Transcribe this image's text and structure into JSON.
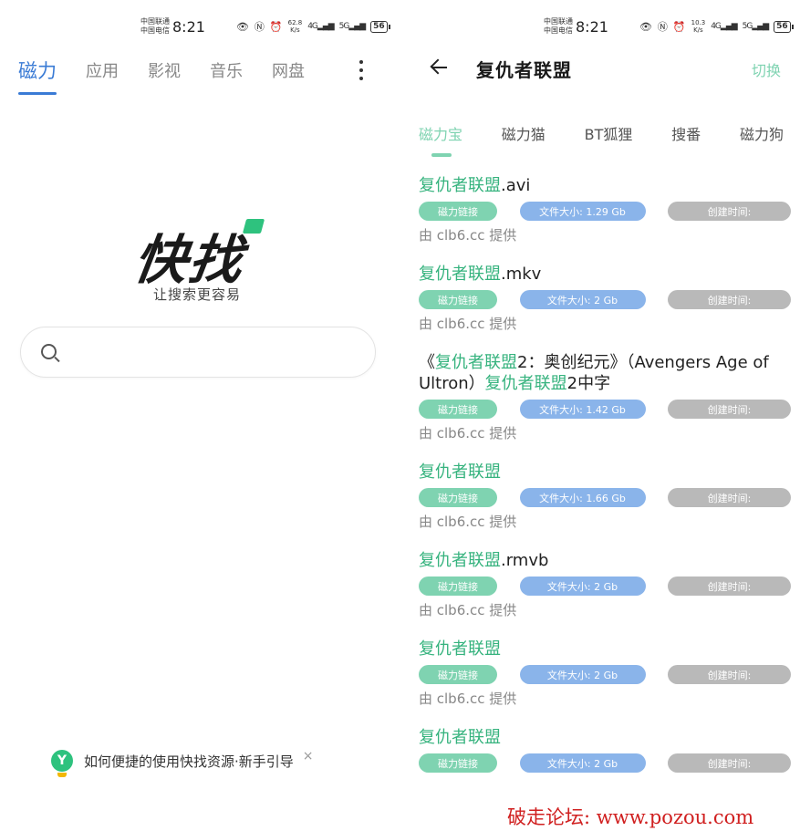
{
  "status_bar": {
    "carrier1": "中国联通",
    "carrier2": "中国电信",
    "time": "8:21",
    "left_speed": "62.8",
    "right_speed": "10.3",
    "speed_unit": "K/s",
    "signal1": "4G",
    "signal2": "5G",
    "battery": "56"
  },
  "home": {
    "tabs": [
      "磁力",
      "应用",
      "影视",
      "音乐",
      "网盘"
    ],
    "logo": "快找",
    "slogan": "让搜索更容易",
    "search_placeholder": "",
    "guide_icon": "Y",
    "guide_text": "如何便捷的使用快找资源·新手引导",
    "close": "×"
  },
  "results_page": {
    "title": "复仇者联盟",
    "switch_label": "切换",
    "source_tabs": [
      "磁力宝",
      "磁力猫",
      "BT狐狸",
      "搜番",
      "磁力狗"
    ],
    "items": [
      {
        "prefix": "",
        "hl": "复仇者联盟",
        "mid": ".avi",
        "hl2": "",
        "suffix": "",
        "magnet": "磁力链接",
        "size": "文件大小: 1.29 Gb",
        "created": "创建时间:",
        "provider": "由 clb6.cc 提供"
      },
      {
        "prefix": "",
        "hl": "复仇者联盟",
        "mid": ".mkv",
        "hl2": "",
        "suffix": "",
        "magnet": "磁力链接",
        "size": "文件大小: 2 Gb",
        "created": "创建时间:",
        "provider": "由 clb6.cc 提供"
      },
      {
        "prefix": "《",
        "hl": "复仇者联盟",
        "mid": "2：奥创纪元》（Avengers Age of Ultron）",
        "hl2": "复仇者联盟",
        "suffix": "2中字",
        "magnet": "磁力链接",
        "size": "文件大小: 1.42 Gb",
        "created": "创建时间:",
        "provider": "由 clb6.cc 提供"
      },
      {
        "prefix": "",
        "hl": "复仇者联盟",
        "mid": "",
        "hl2": "",
        "suffix": "",
        "magnet": "磁力链接",
        "size": "文件大小: 1.66 Gb",
        "created": "创建时间:",
        "provider": "由 clb6.cc 提供"
      },
      {
        "prefix": "",
        "hl": "复仇者联盟",
        "mid": ".rmvb",
        "hl2": "",
        "suffix": "",
        "magnet": "磁力链接",
        "size": "文件大小: 2 Gb",
        "created": "创建时间:",
        "provider": "由 clb6.cc 提供"
      },
      {
        "prefix": "",
        "hl": "复仇者联盟",
        "mid": "",
        "hl2": "",
        "suffix": "",
        "magnet": "磁力链接",
        "size": "文件大小: 2 Gb",
        "created": "创建时间:",
        "provider": "由 clb6.cc 提供"
      },
      {
        "prefix": "",
        "hl": "复仇者联盟",
        "mid": "",
        "hl2": "",
        "suffix": "",
        "magnet": "磁力链接",
        "size": "文件大小: 2 Gb",
        "created": "创建时间:",
        "provider": ""
      }
    ]
  },
  "watermark": "破走论坛: www.pozou.com",
  "colors": {
    "home_accent": "#3a7bd5",
    "results_accent": "#7fd3b1",
    "highlight": "#36b37e",
    "size_tag": "#8ab4ea",
    "time_tag": "#b9b9b9",
    "watermark": "#d02020"
  }
}
